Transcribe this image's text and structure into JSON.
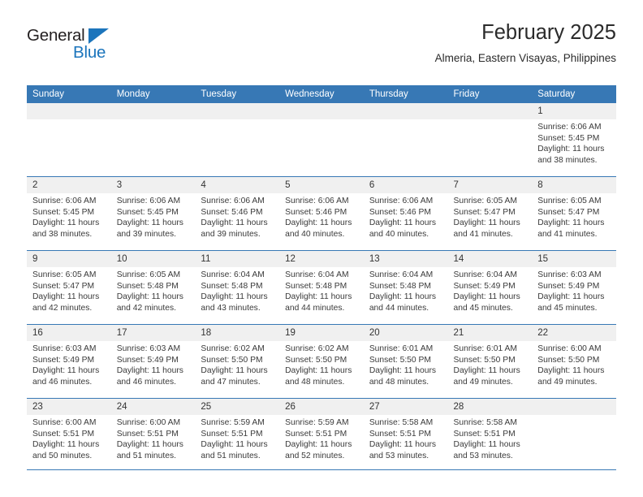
{
  "brand": {
    "name_part1": "General",
    "name_part2": "Blue",
    "triangle_color": "#1c75bc",
    "icon": "triangle-logo-icon"
  },
  "header": {
    "title": "February 2025",
    "subtitle": "Almeria, Eastern Visayas, Philippines"
  },
  "theme": {
    "header_blue": "#3778b5",
    "daynum_bg": "#f0f0f0",
    "text": "#3a3a3a"
  },
  "calendar": {
    "weekday_headers": [
      "Sunday",
      "Monday",
      "Tuesday",
      "Wednesday",
      "Thursday",
      "Friday",
      "Saturday"
    ],
    "weeks": [
      [
        {
          "day": "",
          "lines": []
        },
        {
          "day": "",
          "lines": []
        },
        {
          "day": "",
          "lines": []
        },
        {
          "day": "",
          "lines": []
        },
        {
          "day": "",
          "lines": []
        },
        {
          "day": "",
          "lines": []
        },
        {
          "day": "1",
          "lines": [
            "Sunrise: 6:06 AM",
            "Sunset: 5:45 PM",
            "Daylight: 11 hours",
            "and 38 minutes."
          ]
        }
      ],
      [
        {
          "day": "2",
          "lines": [
            "Sunrise: 6:06 AM",
            "Sunset: 5:45 PM",
            "Daylight: 11 hours",
            "and 38 minutes."
          ]
        },
        {
          "day": "3",
          "lines": [
            "Sunrise: 6:06 AM",
            "Sunset: 5:45 PM",
            "Daylight: 11 hours",
            "and 39 minutes."
          ]
        },
        {
          "day": "4",
          "lines": [
            "Sunrise: 6:06 AM",
            "Sunset: 5:46 PM",
            "Daylight: 11 hours",
            "and 39 minutes."
          ]
        },
        {
          "day": "5",
          "lines": [
            "Sunrise: 6:06 AM",
            "Sunset: 5:46 PM",
            "Daylight: 11 hours",
            "and 40 minutes."
          ]
        },
        {
          "day": "6",
          "lines": [
            "Sunrise: 6:06 AM",
            "Sunset: 5:46 PM",
            "Daylight: 11 hours",
            "and 40 minutes."
          ]
        },
        {
          "day": "7",
          "lines": [
            "Sunrise: 6:05 AM",
            "Sunset: 5:47 PM",
            "Daylight: 11 hours",
            "and 41 minutes."
          ]
        },
        {
          "day": "8",
          "lines": [
            "Sunrise: 6:05 AM",
            "Sunset: 5:47 PM",
            "Daylight: 11 hours",
            "and 41 minutes."
          ]
        }
      ],
      [
        {
          "day": "9",
          "lines": [
            "Sunrise: 6:05 AM",
            "Sunset: 5:47 PM",
            "Daylight: 11 hours",
            "and 42 minutes."
          ]
        },
        {
          "day": "10",
          "lines": [
            "Sunrise: 6:05 AM",
            "Sunset: 5:48 PM",
            "Daylight: 11 hours",
            "and 42 minutes."
          ]
        },
        {
          "day": "11",
          "lines": [
            "Sunrise: 6:04 AM",
            "Sunset: 5:48 PM",
            "Daylight: 11 hours",
            "and 43 minutes."
          ]
        },
        {
          "day": "12",
          "lines": [
            "Sunrise: 6:04 AM",
            "Sunset: 5:48 PM",
            "Daylight: 11 hours",
            "and 44 minutes."
          ]
        },
        {
          "day": "13",
          "lines": [
            "Sunrise: 6:04 AM",
            "Sunset: 5:48 PM",
            "Daylight: 11 hours",
            "and 44 minutes."
          ]
        },
        {
          "day": "14",
          "lines": [
            "Sunrise: 6:04 AM",
            "Sunset: 5:49 PM",
            "Daylight: 11 hours",
            "and 45 minutes."
          ]
        },
        {
          "day": "15",
          "lines": [
            "Sunrise: 6:03 AM",
            "Sunset: 5:49 PM",
            "Daylight: 11 hours",
            "and 45 minutes."
          ]
        }
      ],
      [
        {
          "day": "16",
          "lines": [
            "Sunrise: 6:03 AM",
            "Sunset: 5:49 PM",
            "Daylight: 11 hours",
            "and 46 minutes."
          ]
        },
        {
          "day": "17",
          "lines": [
            "Sunrise: 6:03 AM",
            "Sunset: 5:49 PM",
            "Daylight: 11 hours",
            "and 46 minutes."
          ]
        },
        {
          "day": "18",
          "lines": [
            "Sunrise: 6:02 AM",
            "Sunset: 5:50 PM",
            "Daylight: 11 hours",
            "and 47 minutes."
          ]
        },
        {
          "day": "19",
          "lines": [
            "Sunrise: 6:02 AM",
            "Sunset: 5:50 PM",
            "Daylight: 11 hours",
            "and 48 minutes."
          ]
        },
        {
          "day": "20",
          "lines": [
            "Sunrise: 6:01 AM",
            "Sunset: 5:50 PM",
            "Daylight: 11 hours",
            "and 48 minutes."
          ]
        },
        {
          "day": "21",
          "lines": [
            "Sunrise: 6:01 AM",
            "Sunset: 5:50 PM",
            "Daylight: 11 hours",
            "and 49 minutes."
          ]
        },
        {
          "day": "22",
          "lines": [
            "Sunrise: 6:00 AM",
            "Sunset: 5:50 PM",
            "Daylight: 11 hours",
            "and 49 minutes."
          ]
        }
      ],
      [
        {
          "day": "23",
          "lines": [
            "Sunrise: 6:00 AM",
            "Sunset: 5:51 PM",
            "Daylight: 11 hours",
            "and 50 minutes."
          ]
        },
        {
          "day": "24",
          "lines": [
            "Sunrise: 6:00 AM",
            "Sunset: 5:51 PM",
            "Daylight: 11 hours",
            "and 51 minutes."
          ]
        },
        {
          "day": "25",
          "lines": [
            "Sunrise: 5:59 AM",
            "Sunset: 5:51 PM",
            "Daylight: 11 hours",
            "and 51 minutes."
          ]
        },
        {
          "day": "26",
          "lines": [
            "Sunrise: 5:59 AM",
            "Sunset: 5:51 PM",
            "Daylight: 11 hours",
            "and 52 minutes."
          ]
        },
        {
          "day": "27",
          "lines": [
            "Sunrise: 5:58 AM",
            "Sunset: 5:51 PM",
            "Daylight: 11 hours",
            "and 53 minutes."
          ]
        },
        {
          "day": "28",
          "lines": [
            "Sunrise: 5:58 AM",
            "Sunset: 5:51 PM",
            "Daylight: 11 hours",
            "and 53 minutes."
          ]
        },
        {
          "day": "",
          "lines": []
        }
      ]
    ]
  }
}
